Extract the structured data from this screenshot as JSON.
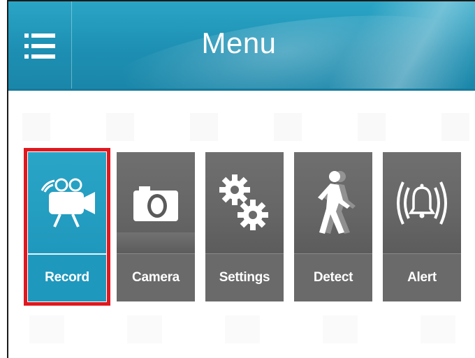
{
  "header": {
    "title": "Menu",
    "menu_icon": "hamburger-menu-icon",
    "accent_color": "#1d8fb2"
  },
  "tiles": [
    {
      "label": "Record",
      "icon": "video-camera-icon",
      "active": true
    },
    {
      "label": "Camera",
      "icon": "camera-icon",
      "active": false
    },
    {
      "label": "Settings",
      "icon": "gears-icon",
      "active": false
    },
    {
      "label": "Detect",
      "icon": "walking-person-icon",
      "active": false
    },
    {
      "label": "Alert",
      "icon": "bell-alarm-icon",
      "active": false
    }
  ],
  "highlight_color": "#e0181f",
  "tile_color": "#6a6a6a",
  "active_tile_color": "#1f98bd"
}
